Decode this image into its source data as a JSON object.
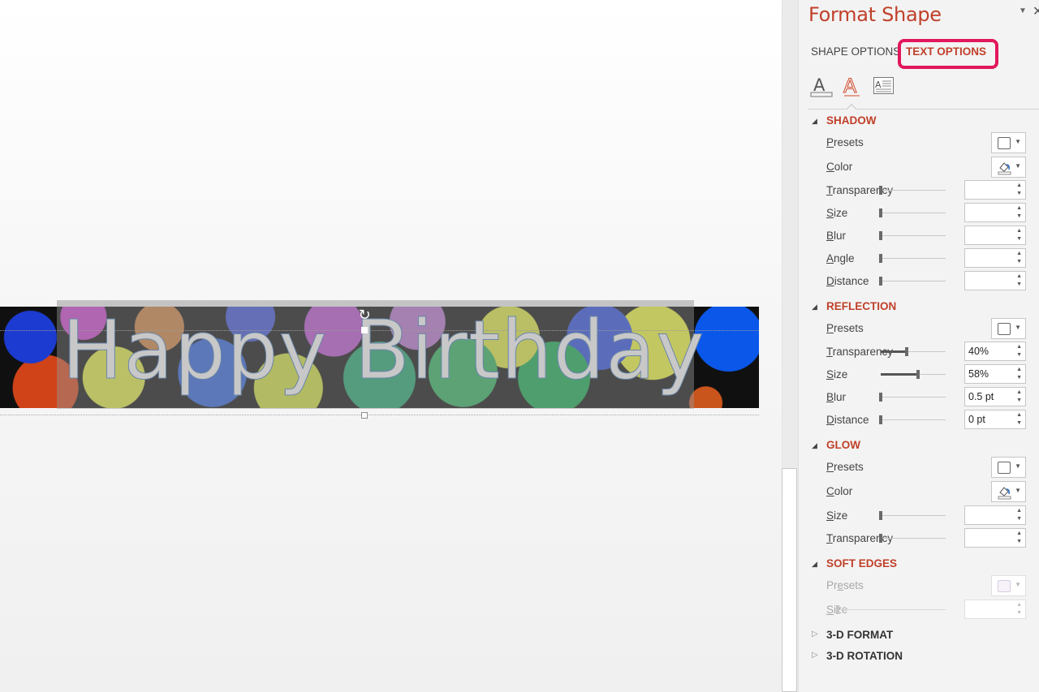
{
  "slide": {
    "title_text": "Happy Birthday",
    "rotate_glyph": "↻"
  },
  "pane": {
    "title": "Format Shape",
    "menu_glyph": "▼",
    "close_glyph": "✕",
    "tabs": [
      {
        "label": "SHAPE OPTIONS",
        "selected": false
      },
      {
        "label": "TEXT OPTIONS",
        "selected": true,
        "highlight_color": "#e2175d"
      }
    ],
    "subtabs": [
      {
        "name": "text-fill-outline",
        "icon": "text-fill-icon"
      },
      {
        "name": "text-effects",
        "icon": "text-effects-icon",
        "selected": true
      },
      {
        "name": "text-box",
        "icon": "text-box-icon"
      }
    ],
    "accent_color": "#c0402a",
    "sections": {
      "shadow": {
        "title": "SHADOW",
        "expanded": true,
        "presets_label": "Presets",
        "color_label": "Color",
        "transparency_label": "Transparency",
        "transparency_value": "",
        "size_label": "Size",
        "size_value": "",
        "blur_label": "Blur",
        "blur_value": "",
        "angle_label": "Angle",
        "angle_value": "",
        "distance_label": "Distance",
        "distance_value": ""
      },
      "reflection": {
        "title": "REFLECTION",
        "expanded": true,
        "presets_label": "Presets",
        "transparency_label": "Transparency",
        "transparency_value": "40%",
        "transparency_slider": 0.4,
        "size_label": "Size",
        "size_value": "58%",
        "size_slider": 0.58,
        "blur_label": "Blur",
        "blur_value": "0.5 pt",
        "blur_slider": 0.0,
        "distance_label": "Distance",
        "distance_value": "0 pt",
        "distance_slider": 0.0
      },
      "glow": {
        "title": "GLOW",
        "expanded": true,
        "presets_label": "Presets",
        "color_label": "Color",
        "size_label": "Size",
        "size_value": "",
        "transparency_label": "Transparency",
        "transparency_value": ""
      },
      "soft_edges": {
        "title": "SOFT EDGES",
        "expanded": true,
        "disabled": true,
        "presets_label": "Presets",
        "size_label": "Size",
        "size_value": ""
      },
      "three_d_format": {
        "title": "3-D FORMAT",
        "expanded": false
      },
      "three_d_rotation": {
        "title": "3-D ROTATION",
        "expanded": false
      }
    },
    "glyphs": {
      "expanded": "◢",
      "collapsed": "▷",
      "caret": "▼",
      "up": "▲",
      "down": "▼"
    }
  }
}
